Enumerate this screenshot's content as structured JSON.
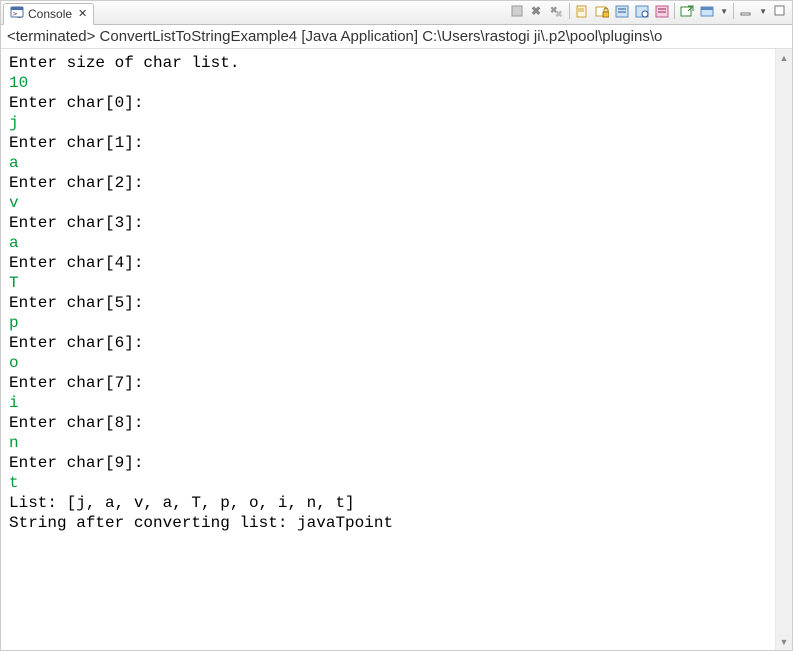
{
  "tab": {
    "title": "Console",
    "close_glyph": "✕"
  },
  "status": "<terminated> ConvertListToStringExample4 [Java Application] C:\\Users\\rastogi ji\\.p2\\pool\\plugins\\o",
  "output": [
    {
      "t": "Enter size of char list.",
      "kind": "out"
    },
    {
      "t": "10",
      "kind": "in"
    },
    {
      "t": "Enter char[0]:",
      "kind": "out"
    },
    {
      "t": "j",
      "kind": "in"
    },
    {
      "t": "Enter char[1]:",
      "kind": "out"
    },
    {
      "t": "a",
      "kind": "in"
    },
    {
      "t": "Enter char[2]:",
      "kind": "out"
    },
    {
      "t": "v",
      "kind": "in"
    },
    {
      "t": "Enter char[3]:",
      "kind": "out"
    },
    {
      "t": "a",
      "kind": "in"
    },
    {
      "t": "Enter char[4]:",
      "kind": "out"
    },
    {
      "t": "T",
      "kind": "in"
    },
    {
      "t": "Enter char[5]:",
      "kind": "out"
    },
    {
      "t": "p",
      "kind": "in"
    },
    {
      "t": "Enter char[6]:",
      "kind": "out"
    },
    {
      "t": "o",
      "kind": "in"
    },
    {
      "t": "Enter char[7]:",
      "kind": "out"
    },
    {
      "t": "i",
      "kind": "in"
    },
    {
      "t": "Enter char[8]:",
      "kind": "out"
    },
    {
      "t": "n",
      "kind": "in"
    },
    {
      "t": "Enter char[9]:",
      "kind": "out"
    },
    {
      "t": "t",
      "kind": "in"
    },
    {
      "t": "List: [j, a, v, a, T, p, o, i, n, t]",
      "kind": "out"
    },
    {
      "t": "String after converting list: javaTpoint",
      "kind": "out"
    }
  ],
  "toolbar": {
    "icons": [
      "terminate-icon",
      "remove-launch-icon",
      "remove-all-terminated-icon",
      "sep",
      "clear-console-icon",
      "scroll-lock-icon",
      "word-wrap-icon",
      "pin-console-icon",
      "display-selected-icon",
      "sep",
      "open-console-icon",
      "drop-arrow",
      "new-console-icon",
      "sep",
      "minimize-icon",
      "drop-arrow",
      "maximize-icon"
    ]
  }
}
